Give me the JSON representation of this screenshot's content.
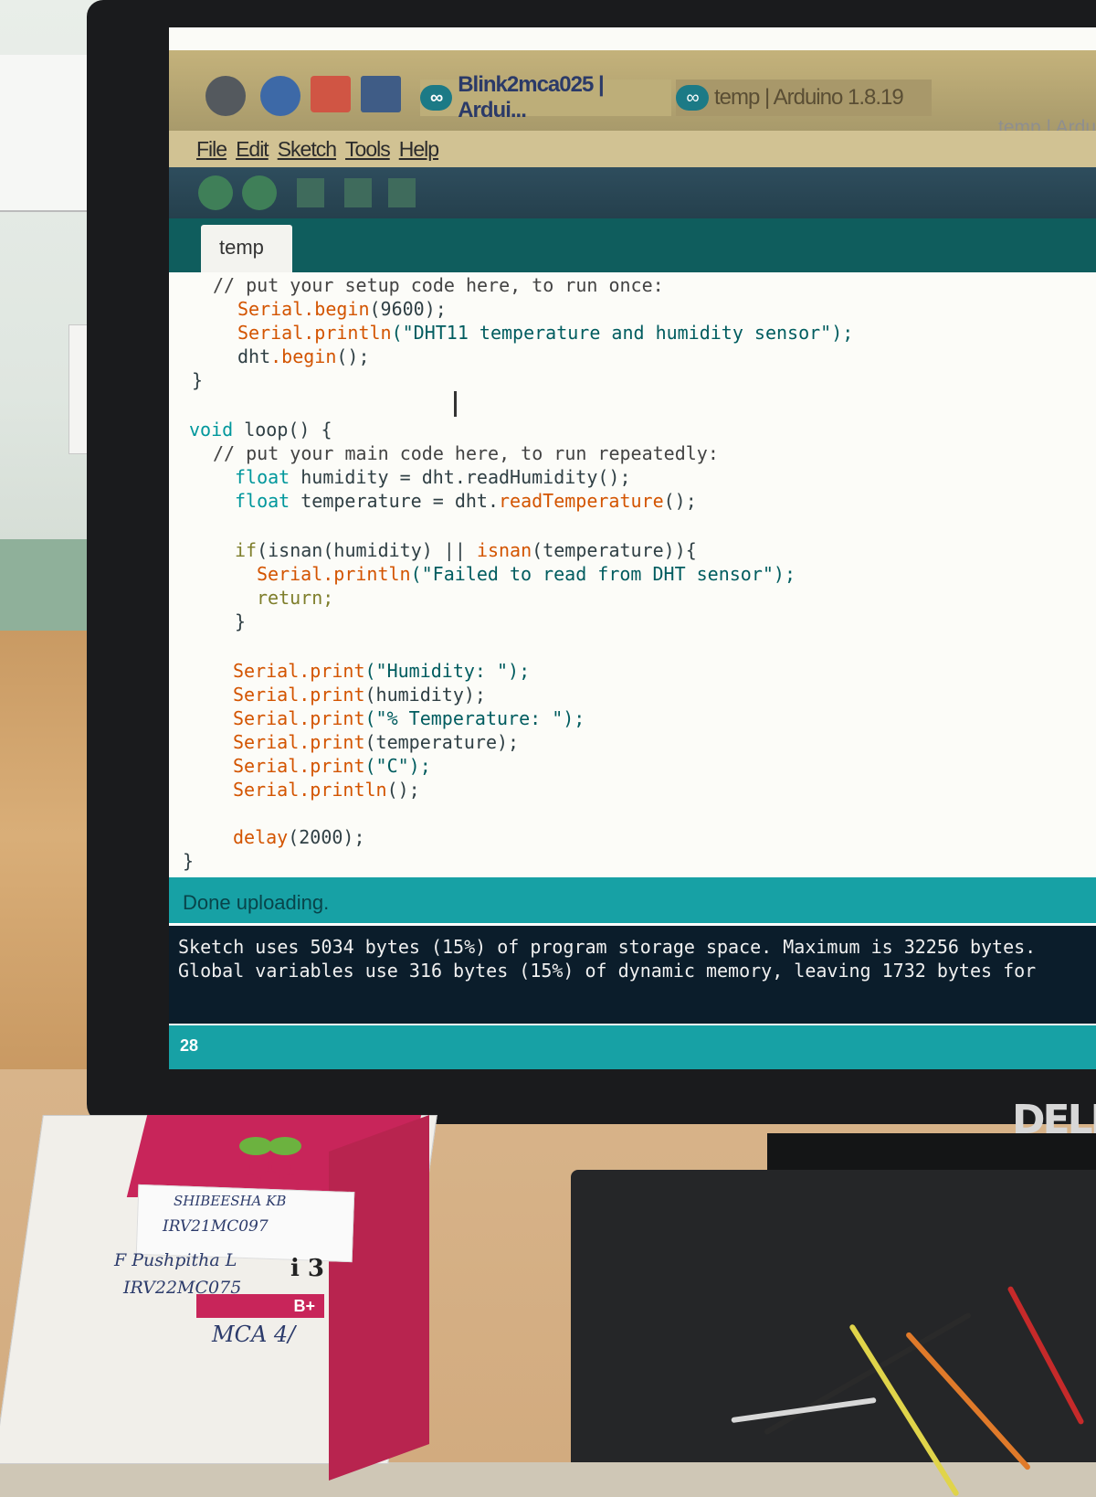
{
  "window": {
    "tabs": [
      {
        "label": "Blink2mca025 | Ardui..."
      },
      {
        "label": "temp | Arduino 1.8.19"
      }
    ],
    "title_right": "temp | Ardu"
  },
  "menu": [
    "File",
    "Edit",
    "Sketch",
    "Tools",
    "Help"
  ],
  "sketch_tab": "temp",
  "code": {
    "l1": "// put your setup code here, to run once:",
    "l2a": "Serial",
    "l2b": ".begin",
    "l2c": "(9600);",
    "l3a": "Serial",
    "l3b": ".println",
    "l3c": "(\"DHT11 temperature and humidity sensor\");",
    "l4a": "dht",
    "l4b": ".begin",
    "l4c": "();",
    "l5": "}",
    "l6a": "void",
    "l6b": " loop() {",
    "l7": "// put your main code here, to run repeatedly:",
    "l8a": "float",
    "l8b": " humidity = dht.readHumidity();",
    "l9a": "float",
    "l9b": " temperature = dht.",
    "l9c": "readTemperature",
    "l9d": "();",
    "l10a": "if",
    "l10b": "(",
    "l10c": "isnan",
    "l10d": "(humidity) || ",
    "l10e": "isnan",
    "l10f": "(temperature)){",
    "l11a": "Serial",
    "l11b": ".println",
    "l11c": "(\"Failed to read from DHT sensor\");",
    "l12": "return;",
    "l13": "}",
    "l14a": "Serial",
    "l14b": ".print",
    "l14c": "(\"Humidity: \");",
    "l15a": "Serial",
    "l15b": ".print",
    "l15c": "(humidity);",
    "l16a": "Serial",
    "l16b": ".print",
    "l16c": "(\"% Temperature: \");",
    "l17a": "Serial",
    "l17b": ".print",
    "l17c": "(temperature);",
    "l18a": "Serial",
    "l18b": ".print",
    "l18c": "(\"C\");",
    "l19a": "Serial",
    "l19b": ".println",
    "l19c": "();",
    "l20a": "delay",
    "l20b": "(2000);",
    "l21": "}"
  },
  "status": "Done uploading.",
  "console": [
    "Sketch uses 5034 bytes (15%) of program storage space. Maximum is 32256 bytes.",
    "Global variables use 316 bytes (15%) of dynamic memory, leaving 1732 bytes for"
  ],
  "footer_line": "28",
  "monitor_brand": "DELL",
  "box": {
    "label1": "SHIBEESHA KB",
    "label2": "IRV21MC097",
    "label3": "F  Pushpitha L",
    "label4": "IRV22MC075",
    "label5": "MCA 4/",
    "model_fragment": "i 3",
    "model_tag": "B+"
  },
  "colors": {
    "arduino_teal": "#17a1a5",
    "console_bg": "#0b1d2b",
    "keyword": "#00979c",
    "function": "#d35400"
  }
}
